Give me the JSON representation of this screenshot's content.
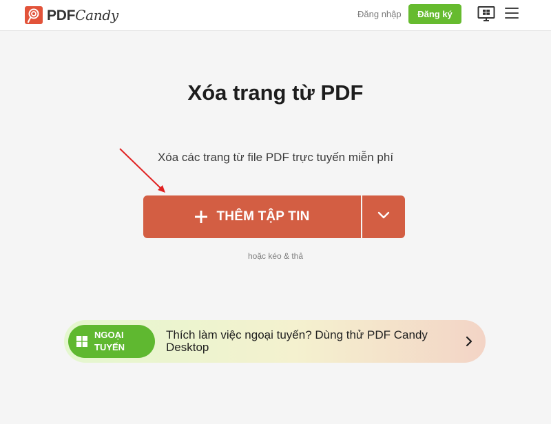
{
  "header": {
    "logo": {
      "pdf": "PDF",
      "candy": "Candy"
    },
    "login_label": "Đăng nhập",
    "signup_label": "Đăng ký",
    "icons": [
      "logo-icon",
      "windows-desktop-icon",
      "hamburger-menu-icon"
    ]
  },
  "main": {
    "title": "Xóa trang từ PDF",
    "subtitle": "Xóa các trang từ file PDF trực tuyến miễn phí",
    "add_button_label": "THÊM TẬP TIN",
    "drag_hint": "hoặc kéo & thả"
  },
  "offline_banner": {
    "badge_line1": "NGOẠI",
    "badge_line2": "TUYẾN",
    "text": "Thích làm việc ngoại tuyến? Dùng thử PDF Candy Desktop"
  },
  "colors": {
    "accent": "#d35e43",
    "signup_green": "#66bb2f",
    "badge_green": "#5fb830",
    "arrow": "#e02020",
    "background": "#f5f5f5"
  }
}
